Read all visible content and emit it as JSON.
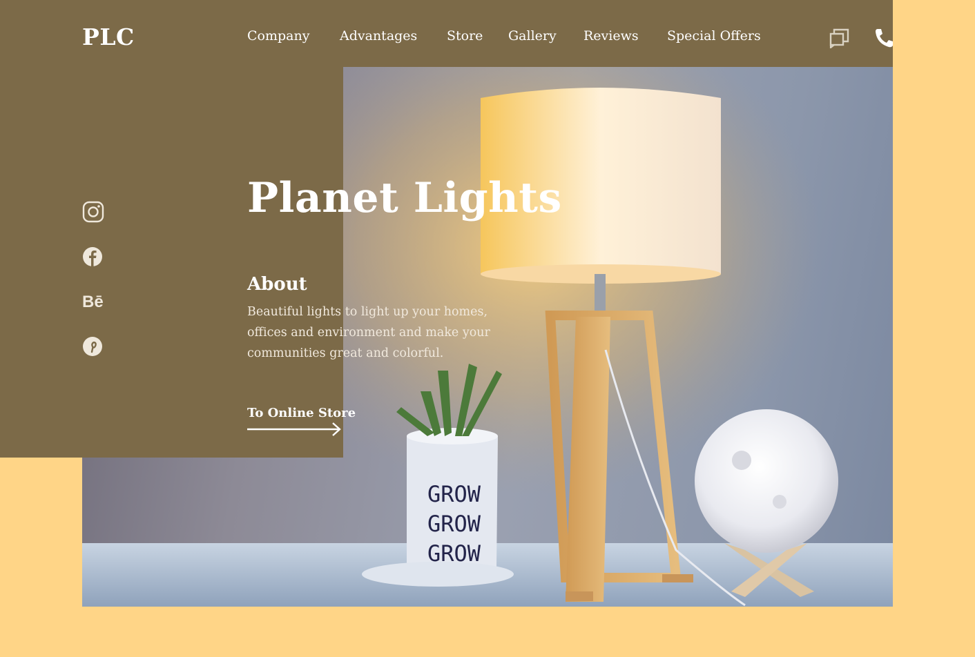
{
  "brand": {
    "logo": "PLC"
  },
  "nav": {
    "items": [
      {
        "label": "Company"
      },
      {
        "label": "Advantages"
      },
      {
        "label": "Store"
      },
      {
        "label": "Gallery"
      },
      {
        "label": "Reviews"
      },
      {
        "label": "Special Offers"
      }
    ],
    "icons": [
      "chat-icon",
      "phone-icon"
    ]
  },
  "social": [
    "instagram-icon",
    "facebook-icon",
    "behance-icon",
    "pinterest-icon"
  ],
  "hero": {
    "title": "Planet Lights",
    "about_heading": "About",
    "about_text": "Beautiful lights to light up your homes, offices and environment and make your communities great and colorful.",
    "cta_label": "To Online Store"
  },
  "photo": {
    "pot_text": [
      "GROW",
      "GROW",
      "GROW"
    ]
  },
  "colors": {
    "background": "#ffd587",
    "panel": "#7c6a48",
    "text": "#ffffff"
  }
}
